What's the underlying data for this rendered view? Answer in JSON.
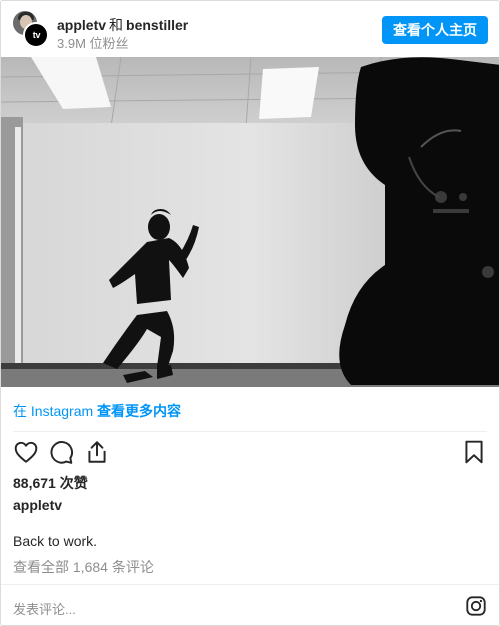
{
  "header": {
    "account_primary": "appletv",
    "joiner": "和",
    "account_secondary": "benstiller",
    "followers": "3.9M 位粉丝",
    "view_profile": "查看个人主页",
    "avatar_badge": "tv"
  },
  "photo": {
    "alt_hint": "black and white photo of a man in a suit running in an office hallway, film camera in foreground",
    "icon": "post-photo"
  },
  "view_more": {
    "prefix": "在 Instagram",
    "suffix": "查看更多内容"
  },
  "actions": {
    "like_icon": "heart-icon",
    "comment_icon": "comment-icon",
    "share_icon": "share-icon",
    "save_icon": "bookmark-icon"
  },
  "post": {
    "likes": "88,671 次赞",
    "author": "appletv",
    "caption": "Back to work.",
    "view_comments": "查看全部 1,684 条评论"
  },
  "comment_box": {
    "placeholder": "发表评论...",
    "logo_icon": "instagram-icon"
  },
  "colors": {
    "accent": "#0095f6",
    "text": "#262626",
    "muted": "#8e8e8e",
    "border": "#dbdbdb"
  }
}
